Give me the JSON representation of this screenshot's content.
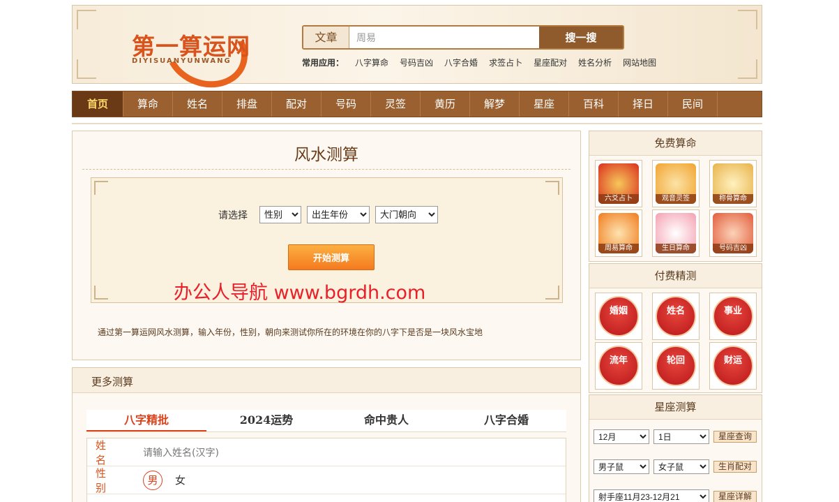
{
  "header": {
    "logo_title": "第一算运网",
    "logo_sub": "DIYISUANYUNWANG",
    "search_category": "文章",
    "search_value": "周易",
    "search_button": "搜一搜",
    "quick_label": "常用应用：",
    "quick_links": [
      "八字算命",
      "号码吉凶",
      "八字合婚",
      "求签占卜",
      "星座配对",
      "姓名分析",
      "网站地图"
    ]
  },
  "nav": [
    "首页",
    "算命",
    "姓名",
    "排盘",
    "配对",
    "号码",
    "灵签",
    "黄历",
    "解梦",
    "星座",
    "百科",
    "择日",
    "民间"
  ],
  "main": {
    "heading": "风水测算",
    "select_label": "请选择",
    "select_gender": "性别",
    "select_year": "出生年份",
    "select_door": "大门朝向",
    "start_button": "开始测算",
    "watermark": "办公人导航 www.bgrdh.com",
    "description": "通过第一算运网风水测算，输入年份，性别，朝向来测试你所在的环境在你的八字下是否是一块风水宝地"
  },
  "more": {
    "title": "更多测算",
    "tabs": [
      "八字精批",
      "2024运势",
      "命中贵人",
      "八字合婚"
    ],
    "name_label": "姓名",
    "name_placeholder": "请输入姓名(汉字)",
    "gender_label": "性别",
    "gender_male": "男",
    "gender_female": "女"
  },
  "sidebar": {
    "free_title": "免费算命",
    "free_items": [
      "六爻占卜",
      "观音灵签",
      "称骨算命",
      "周易算命",
      "生日算命",
      "号码吉凶"
    ],
    "free_colors": [
      "#d9301f",
      "#f2a330",
      "#e8b24a",
      "#f07b1c",
      "#f4a0b0",
      "#e25c3b"
    ],
    "paid_title": "付费精测",
    "paid_items": [
      "婚姻",
      "姓名",
      "事业",
      "流年",
      "轮回",
      "财运"
    ],
    "star_title": "星座测算",
    "star_month": "12月",
    "star_day": "1日",
    "star_query": "星座查询",
    "male_zodiac": "男子鼠",
    "female_zodiac": "女子鼠",
    "zodiac_match": "生肖配对",
    "sign_select": "射手座11月23-12月21",
    "sign_detail": "星座详解"
  }
}
